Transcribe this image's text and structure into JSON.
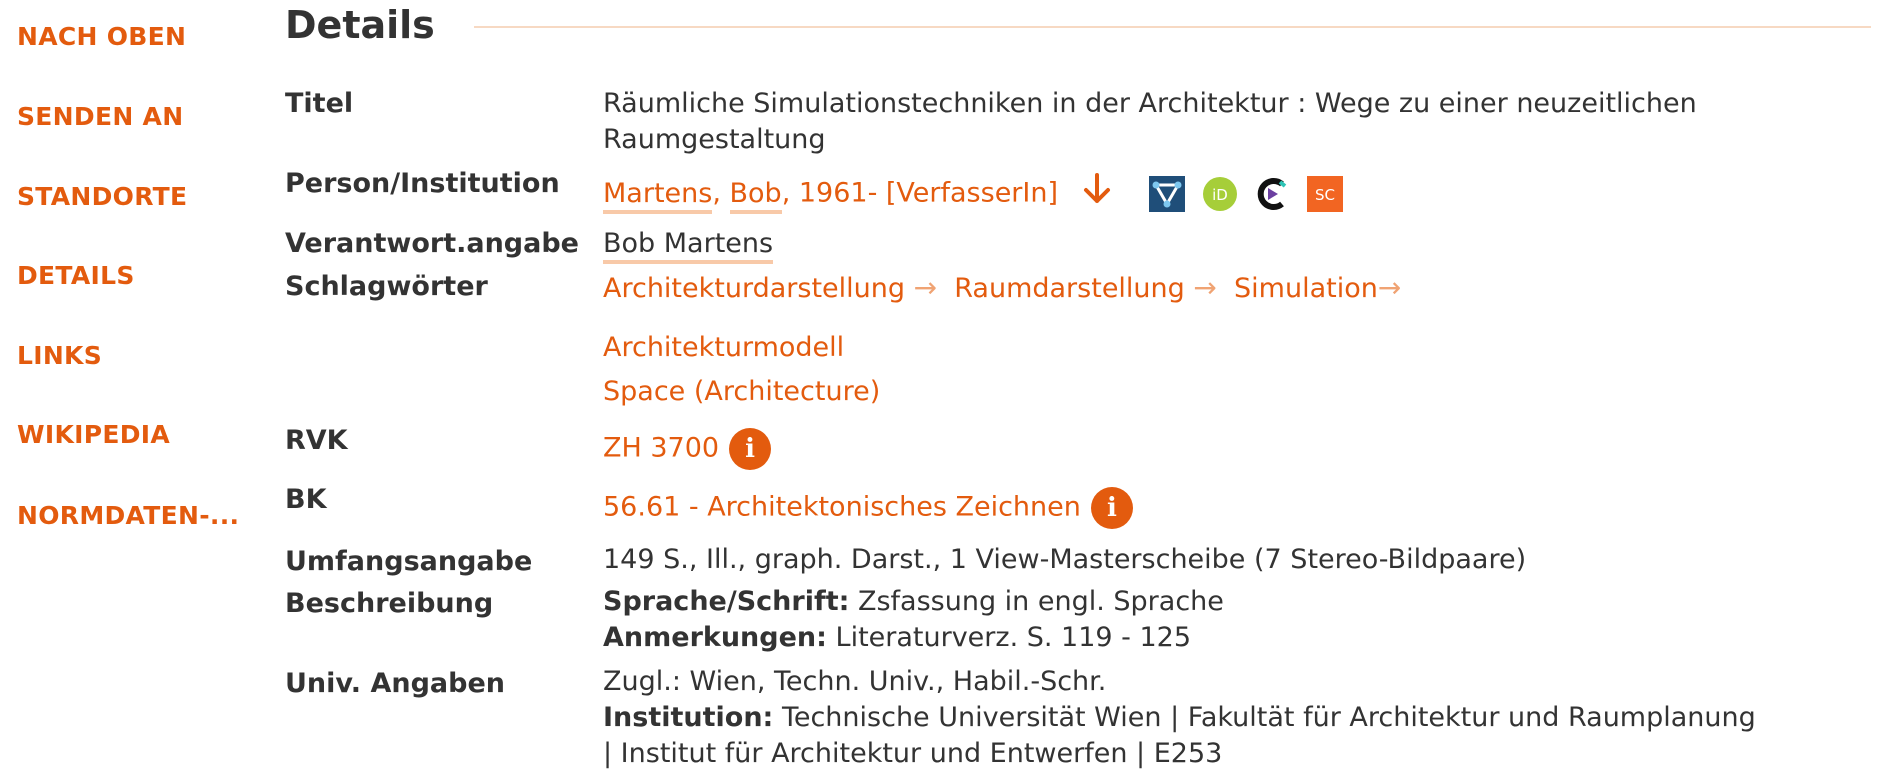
{
  "sidebar": {
    "items": [
      {
        "label": "NACH OBEN"
      },
      {
        "label": "SENDEN AN"
      },
      {
        "label": "STANDORTE"
      },
      {
        "label": "DETAILS"
      },
      {
        "label": "LINKS"
      },
      {
        "label": "WIKIPEDIA"
      },
      {
        "label": "NORMDATEN-..."
      }
    ]
  },
  "details": {
    "heading": "Details",
    "titel_label": "Titel",
    "titel_line1": "Räumliche Simulationstechniken in der Architektur : Wege zu einer neuzeitlichen",
    "titel_line2": "Raumgestaltung",
    "person_label": "Person/Institution",
    "person_surname": "Martens",
    "person_comma1": ", ",
    "person_firstname": "Bob",
    "person_rest": ", 1961- [VerfasserIn]",
    "person_icons": [
      "wikidata-icon",
      "orcid-icon",
      "culturegraph-icon",
      "sc-icon"
    ],
    "sc_text": "SC",
    "orcid_text": "iD",
    "verantwort_label": "Verantwort.angabe",
    "verantwort_value": "Bob Martens",
    "schlag_label": "Schlagwörter",
    "schlag_chain": [
      "Architekturdarstellung",
      "Raumdarstellung",
      "Simulation"
    ],
    "schlag_more": [
      "Architekturmodell",
      "Space (Architecture)"
    ],
    "rvk_label": "RVK",
    "rvk_value": "ZH 3700",
    "bk_label": "BK",
    "bk_value": "56.61 - Architektonisches Zeichnen",
    "info_glyph": "i",
    "umfang_label": "Umfangsangabe",
    "umfang_value": "149 S., Ill., graph. Darst., 1 View-Masterscheibe (7 Stereo-Bildpaare)",
    "beschreibung_label": "Beschreibung",
    "sprache_key": "Sprache/Schrift:",
    "sprache_value": " Zsfassung in engl. Sprache",
    "anmerk_key": "Anmerkungen:",
    "anmerk_value": " Literaturverz. S. 119 - 125",
    "univ_label": "Univ. Angaben",
    "univ_line1": "Zugl.: Wien, Techn. Univ., Habil.-Schr.",
    "inst_key": "Institution:",
    "inst_value": " Technische Universität Wien | Fakultät für Architektur und Raumplanung",
    "inst_line2": "| Institut für Architektur und Entwerfen | E253"
  },
  "colors": {
    "accent": "#e35b0e",
    "accent_light": "#f0a373",
    "underline": "#f8c9a8",
    "text": "#333333"
  }
}
